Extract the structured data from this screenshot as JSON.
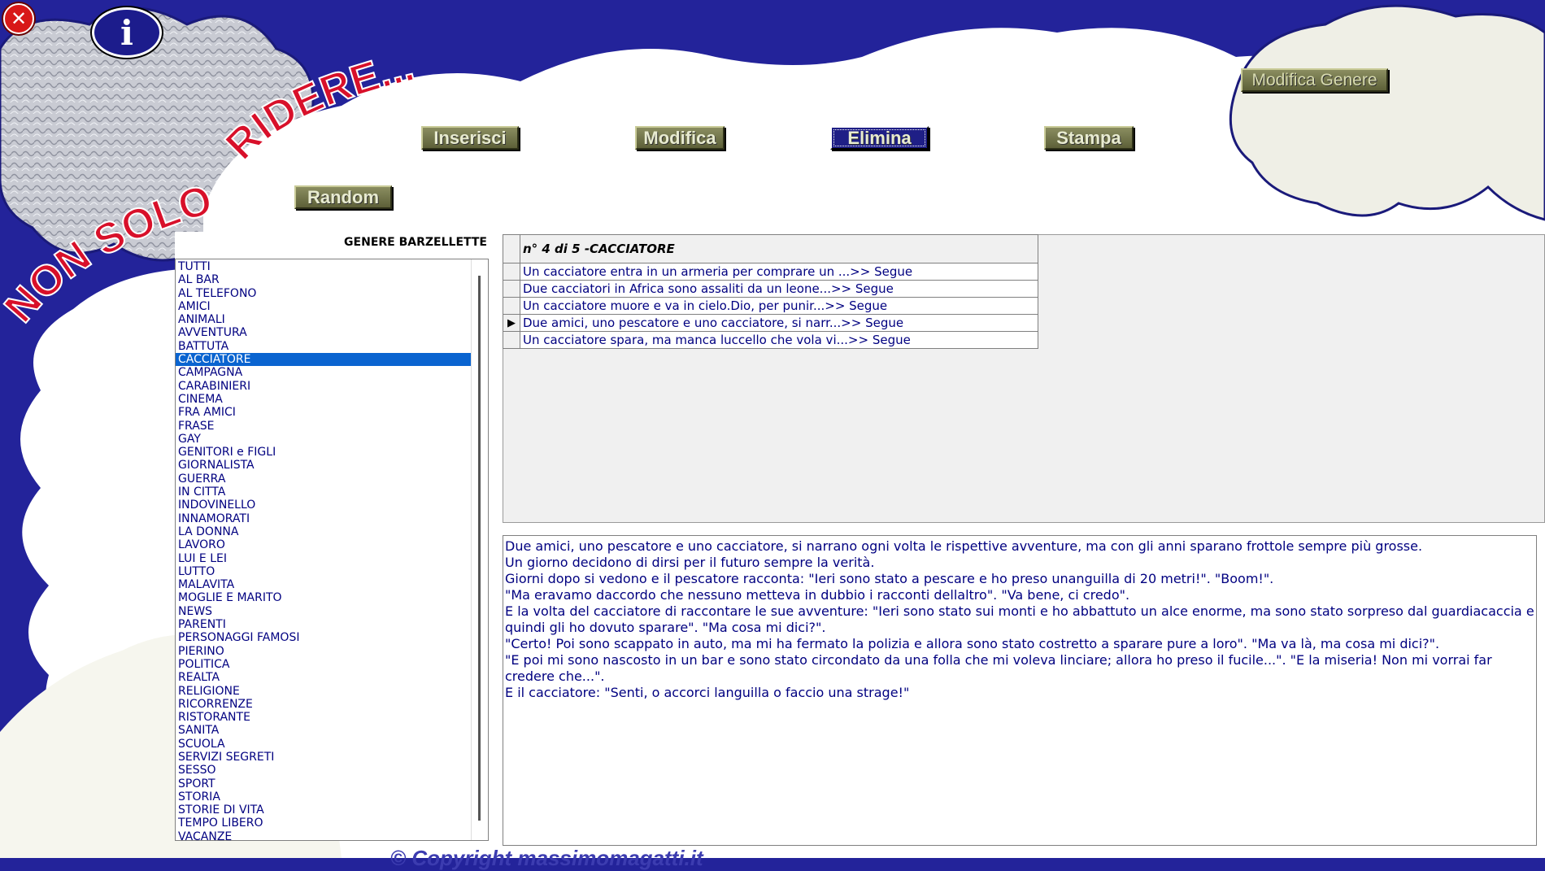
{
  "window": {
    "close_icon": "close-x-icon",
    "info_icon": "info-icon",
    "info_glyph": "i"
  },
  "logo": {
    "line1": "NON SOLO",
    "line2": "RIDERE..."
  },
  "toolbar": {
    "insert_label": "Inserisci",
    "edit_label": "Modifica",
    "delete_label": "Elimina",
    "print_label": "Stampa",
    "random_label": "Random",
    "edit_genre_label": "Modifica Genere"
  },
  "genre_list": {
    "title": "GENERE BARZELLETTE",
    "selected": "CACCIATORE",
    "items": [
      "TUTTI",
      "AL BAR",
      "AL TELEFONO",
      "AMICI",
      "ANIMALI",
      "AVVENTURA",
      "BATTUTA",
      "CACCIATORE",
      "CAMPAGNA",
      "CARABINIERI",
      "CINEMA",
      "FRA AMICI",
      "FRASE",
      "GAY",
      "GENITORI e FIGLI",
      "GIORNALISTA",
      "GUERRA",
      "IN CITTA",
      "INDOVINELLO",
      "INNAMORATI",
      "LA DONNA",
      "LAVORO",
      "LUI E LEI",
      "LUTTO",
      "MALAVITA",
      "MOGLIE E MARITO",
      "NEWS",
      "PARENTI",
      "PERSONAGGI FAMOSI",
      "PIERINO",
      "POLITICA",
      "REALTA",
      "RELIGIONE",
      "RICORRENZE",
      "RISTORANTE",
      "SANITA",
      "SCUOLA",
      "SERVIZI SEGRETI",
      "SESSO",
      "SPORT",
      "STORIA",
      "STORIE DI VITA",
      "TEMPO LIBERO",
      "VACANZE"
    ]
  },
  "jokes_grid": {
    "header": "n° 4 di 5  -CACCIATORE",
    "current_index": 3,
    "rows": [
      "Un cacciatore entra in un armeria per comprare un ...>>  Segue",
      "Due cacciatori in Africa sono assaliti da un leone...>>  Segue",
      "Un cacciatore muore e va in cielo.Dio, per punir...>>  Segue",
      "Due amici, uno pescatore e uno cacciatore, si narr...>>  Segue",
      "Un cacciatore spara, ma manca luccello che vola vi...>>  Segue"
    ]
  },
  "joke_text": {
    "lines": [
      "Due amici, uno pescatore e uno cacciatore, si narrano ogni volta le rispettive avventure, ma con gli anni sparano frottole sempre più grosse.",
      "Un giorno decidono di dirsi per il futuro sempre la verità.",
      "Giorni dopo si vedono e il pescatore racconta: \"Ieri sono stato a pescare e ho preso unanguilla di 20 metri!\". \"Boom!\".",
      "\"Ma eravamo daccordo che nessuno metteva in dubbio i racconti dellaltro\". \"Va bene, ci credo\".",
      "E la volta del cacciatore di raccontare le sue avventure: \"Ieri sono stato sui monti e ho abbattuto un alce enorme, ma sono stato sorpreso dal guardiacaccia e quindi gli ho dovuto sparare\". \"Ma cosa mi dici?\".",
      "\"Certo! Poi sono scappato in auto, ma mi ha fermato la polizia e allora sono stato costretto a sparare pure a loro\". \"Ma va là, ma cosa mi dici?\".",
      "\"E poi mi sono nascosto in un bar e sono stato circondato da una folla che mi voleva linciare; allora ho preso il fucile...\". \"E la miseria! Non mi vorrai far credere che...\".",
      "E il cacciatore: \"Senti, o accorci languilla o faccio una strage!\""
    ]
  },
  "footer": {
    "copyright": "© Copyright massimomagatti.it"
  },
  "colors": {
    "background": "#23239a",
    "cloud": "#ffffff",
    "selection": "#0a64d0",
    "text_blue": "#000080",
    "logo_red": "#d8102a"
  }
}
